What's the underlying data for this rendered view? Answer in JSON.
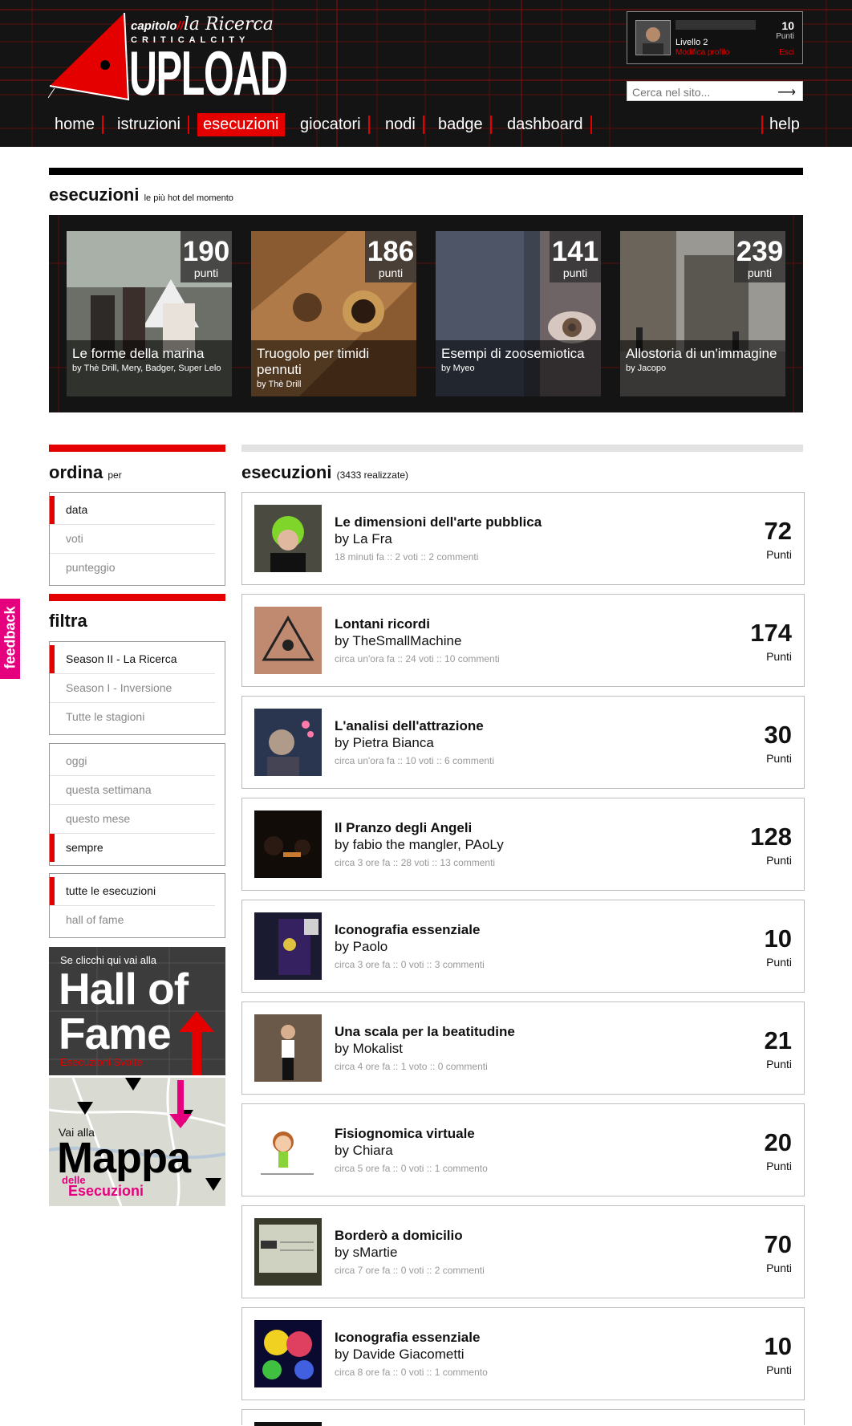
{
  "brand": {
    "chapter": "capitolo",
    "chapter_name": "la Ricerca",
    "subtitle": "CRITICALCITY",
    "title": "UPLOAD"
  },
  "user": {
    "level": "Livello 2",
    "edit_profile": "Modifica profilo",
    "points": "10",
    "points_label": "Punti",
    "logout": "Esci"
  },
  "search": {
    "placeholder": "Cerca nel sito...",
    "icon": "arrow-right-icon"
  },
  "nav": {
    "items": [
      {
        "label": "home"
      },
      {
        "label": "istruzioni"
      },
      {
        "label": "esecuzioni"
      },
      {
        "label": "giocatori"
      },
      {
        "label": "nodi"
      },
      {
        "label": "badge"
      },
      {
        "label": "dashboard"
      }
    ],
    "active": "esecuzioni",
    "help": "help"
  },
  "hot": {
    "title": "esecuzioni",
    "subtitle": "le più hot del momento",
    "cards": [
      {
        "score": "190",
        "label": "punti",
        "title": "Le forme della marina",
        "by": "by Thè Drill, Mery, Badger, Super Lelo"
      },
      {
        "score": "186",
        "label": "punti",
        "title": "Truogolo per timidi pennuti",
        "by": "by Thè Drill"
      },
      {
        "score": "141",
        "label": "punti",
        "title": "Esempi di zoosemiotica",
        "by": "by Myeo"
      },
      {
        "score": "239",
        "label": "punti",
        "title": "Allostoria di un'immagine",
        "by": "by Jacopo"
      }
    ]
  },
  "sidebar": {
    "ordina": {
      "title": "ordina",
      "suffix": "per",
      "items": [
        "data",
        "voti",
        "punteggio"
      ],
      "selected": 0
    },
    "filtra": {
      "title": "filtra",
      "seasons": [
        "Season II - La Ricerca",
        "Season I - Inversione",
        "Tutte le stagioni"
      ],
      "seasons_selected": 0
    },
    "periods": [
      "oggi",
      "questa settimana",
      "questo mese",
      "sempre"
    ],
    "periods_selected": 3,
    "scope": [
      "tutte le esecuzioni",
      "hall of fame"
    ],
    "scope_selected": 0,
    "promo_hof": {
      "intro": "Se clicchi qui vai alla",
      "big1": "Hall of",
      "big2": "Fame",
      "sub": "Esecuzioni Svolte"
    },
    "promo_map": {
      "intro": "Vai alla",
      "big": "Mappa",
      "delle": "delle",
      "esec": "Esecuzioni"
    }
  },
  "feedback": "feedback",
  "list": {
    "title": "esecuzioni",
    "count": "(3433 realizzate)",
    "items": [
      {
        "title": "Le dimensioni dell'arte pubblica",
        "by": "by La Fra",
        "meta": "18 minuti fa :: 2 voti :: 2 commenti",
        "points": "72",
        "points_label": "Punti"
      },
      {
        "title": "Lontani ricordi",
        "by": "by TheSmallMachine",
        "meta": "circa un'ora fa :: 24 voti :: 10 commenti",
        "points": "174",
        "points_label": "Punti"
      },
      {
        "title": "L'analisi dell'attrazione",
        "by": "by Pietra Bianca",
        "meta": "circa un'ora fa :: 10 voti :: 6 commenti",
        "points": "30",
        "points_label": "Punti"
      },
      {
        "title": "Il Pranzo degli Angeli",
        "by": "by fabio the mangler, PAoLy",
        "meta": "circa 3 ore fa :: 28 voti :: 13 commenti",
        "points": "128",
        "points_label": "Punti"
      },
      {
        "title": "Iconografia essenziale",
        "by": "by Paolo",
        "meta": "circa 3 ore fa :: 0 voti :: 3 commenti",
        "points": "10",
        "points_label": "Punti"
      },
      {
        "title": "Una scala per la beatitudine",
        "by": "by Mokalist",
        "meta": "circa 4 ore fa :: 1 voto :: 0 commenti",
        "points": "21",
        "points_label": "Punti"
      },
      {
        "title": "Fisiognomica virtuale",
        "by": "by Chiara",
        "meta": "circa 5 ore fa :: 0 voti :: 1 commento",
        "points": "20",
        "points_label": "Punti"
      },
      {
        "title": "Borderò a domicilio",
        "by": "by sMartie",
        "meta": "circa 7 ore fa :: 0 voti :: 2 commenti",
        "points": "70",
        "points_label": "Punti"
      },
      {
        "title": "Iconografia essenziale",
        "by": "by Davide Giacometti",
        "meta": "circa 8 ore fa :: 0 voti :: 1 commento",
        "points": "10",
        "points_label": "Punti"
      }
    ]
  },
  "colors": {
    "accent": "#e50000",
    "header_bg": "#141414",
    "feedback": "#e5007e"
  }
}
